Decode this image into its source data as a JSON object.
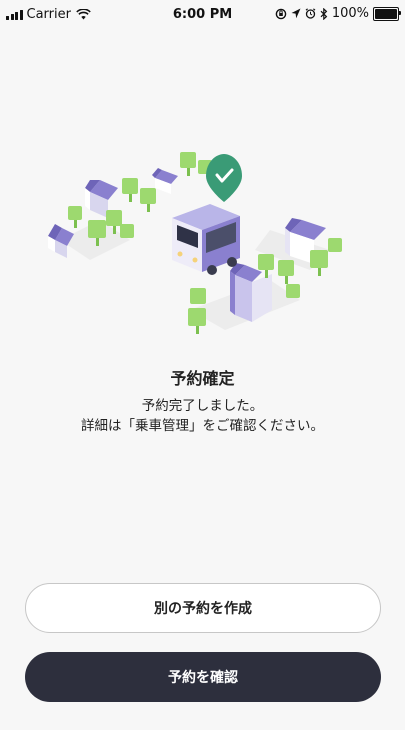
{
  "status_bar": {
    "carrier": "Carrier",
    "time": "6:00 PM",
    "battery": "100%",
    "icons": [
      "signal-icon",
      "wifi-icon",
      "rotation-lock-icon",
      "location-icon",
      "alarm-icon",
      "bluetooth-icon",
      "battery-icon"
    ]
  },
  "illustration": {
    "icon": "bus-with-check-marker-illustration",
    "colors": {
      "bus": "#b9b5e8",
      "roof": "#8a80cf",
      "tree": "#9dd96f",
      "marker": "#3a9b76"
    }
  },
  "confirmation": {
    "title": "予約確定",
    "message_line1": "予約完了しました。",
    "message_line2": "詳細は「乗車管理」をご確認ください。"
  },
  "actions": {
    "create_another_label": "別の予約を作成",
    "confirm_reservation_label": "予約を確認"
  },
  "colors": {
    "primary_button": "#2d2f3d",
    "background": "#f7f7f7"
  }
}
